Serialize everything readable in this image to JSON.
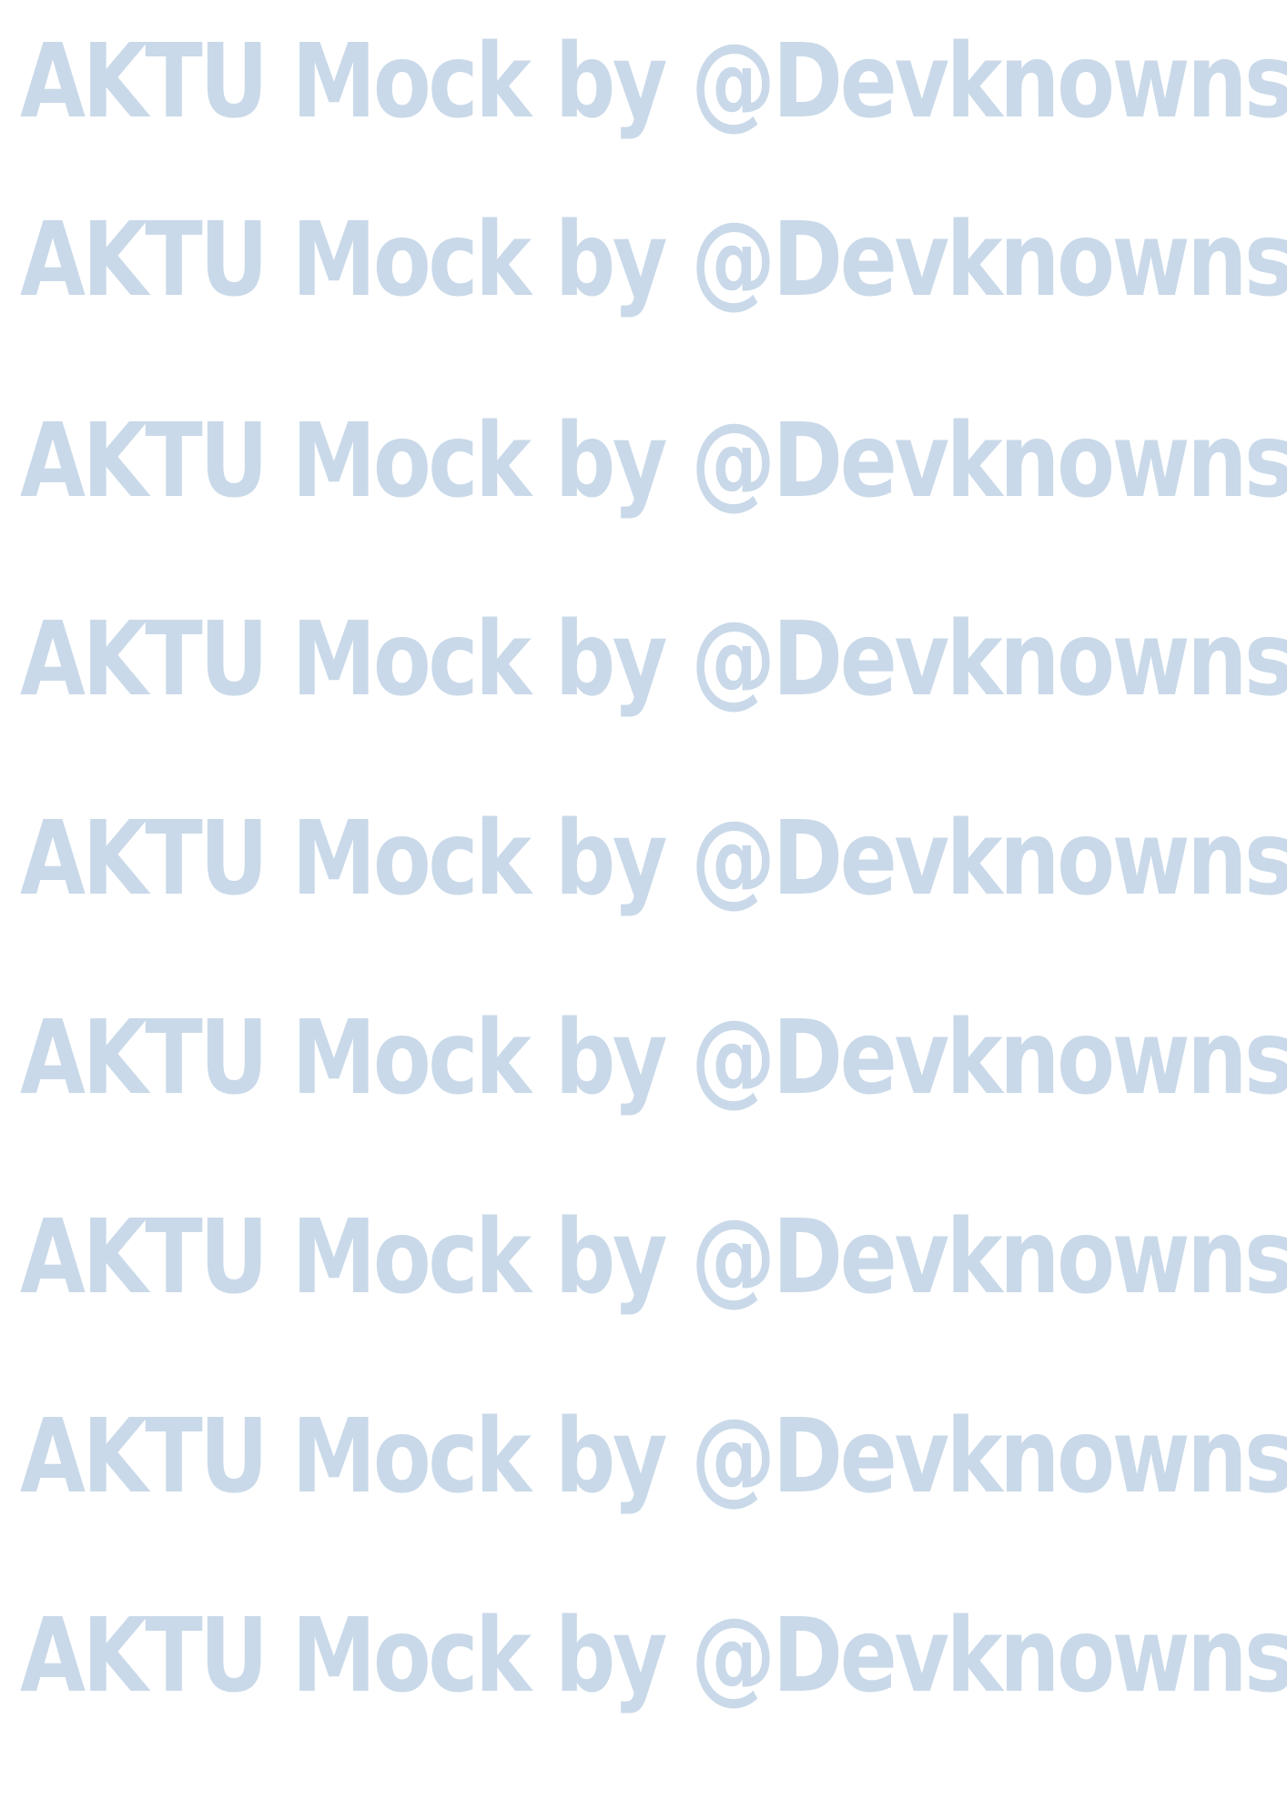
{
  "watermark": {
    "text": "AKTU Mock by @Devknowns",
    "color": "#c9d9e9",
    "lines": [
      "AKTU Mock by @Devknowns",
      "AKTU Mock by @Devknowns",
      "AKTU Mock by @Devknowns",
      "AKTU Mock by @Devknowns",
      "AKTU Mock by @Devknowns",
      "AKTU Mock by @Devknowns",
      "AKTU Mock by @Devknowns",
      "AKTU Mock by @Devknowns",
      "AKTU Mock by @Devknowns"
    ]
  },
  "colors": {
    "page_background": "#ffffff",
    "watermark": "#c9d9e9"
  }
}
